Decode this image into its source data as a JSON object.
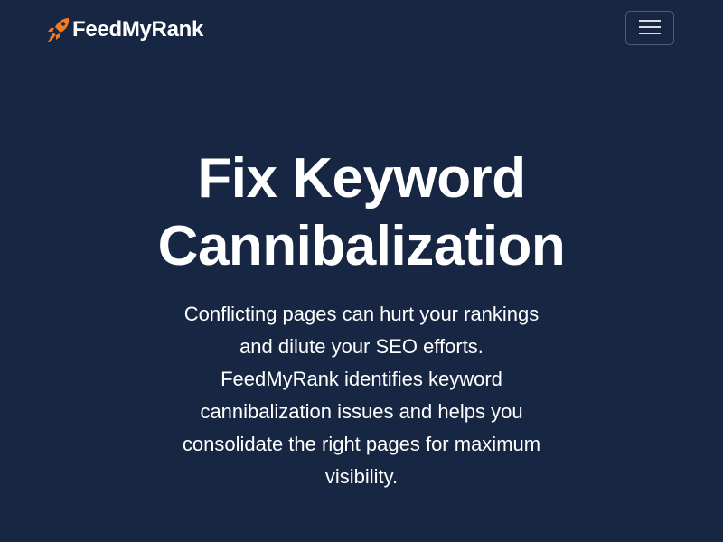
{
  "navbar": {
    "brand_name": "FeedMyRank",
    "brand_icon": "rocket-icon",
    "menu_icon": "hamburger-menu-icon"
  },
  "hero": {
    "title_line1": "Fix Keyword",
    "title_line2": "Cannibalization",
    "description": "Conflicting pages can hurt your rankings and dilute your SEO efforts. FeedMyRank identifies keyword cannibalization issues and helps you consolidate the right pages for maximum visibility."
  },
  "colors": {
    "background": "#172642",
    "text": "#ffffff",
    "brand_accent": "#f47a20"
  }
}
